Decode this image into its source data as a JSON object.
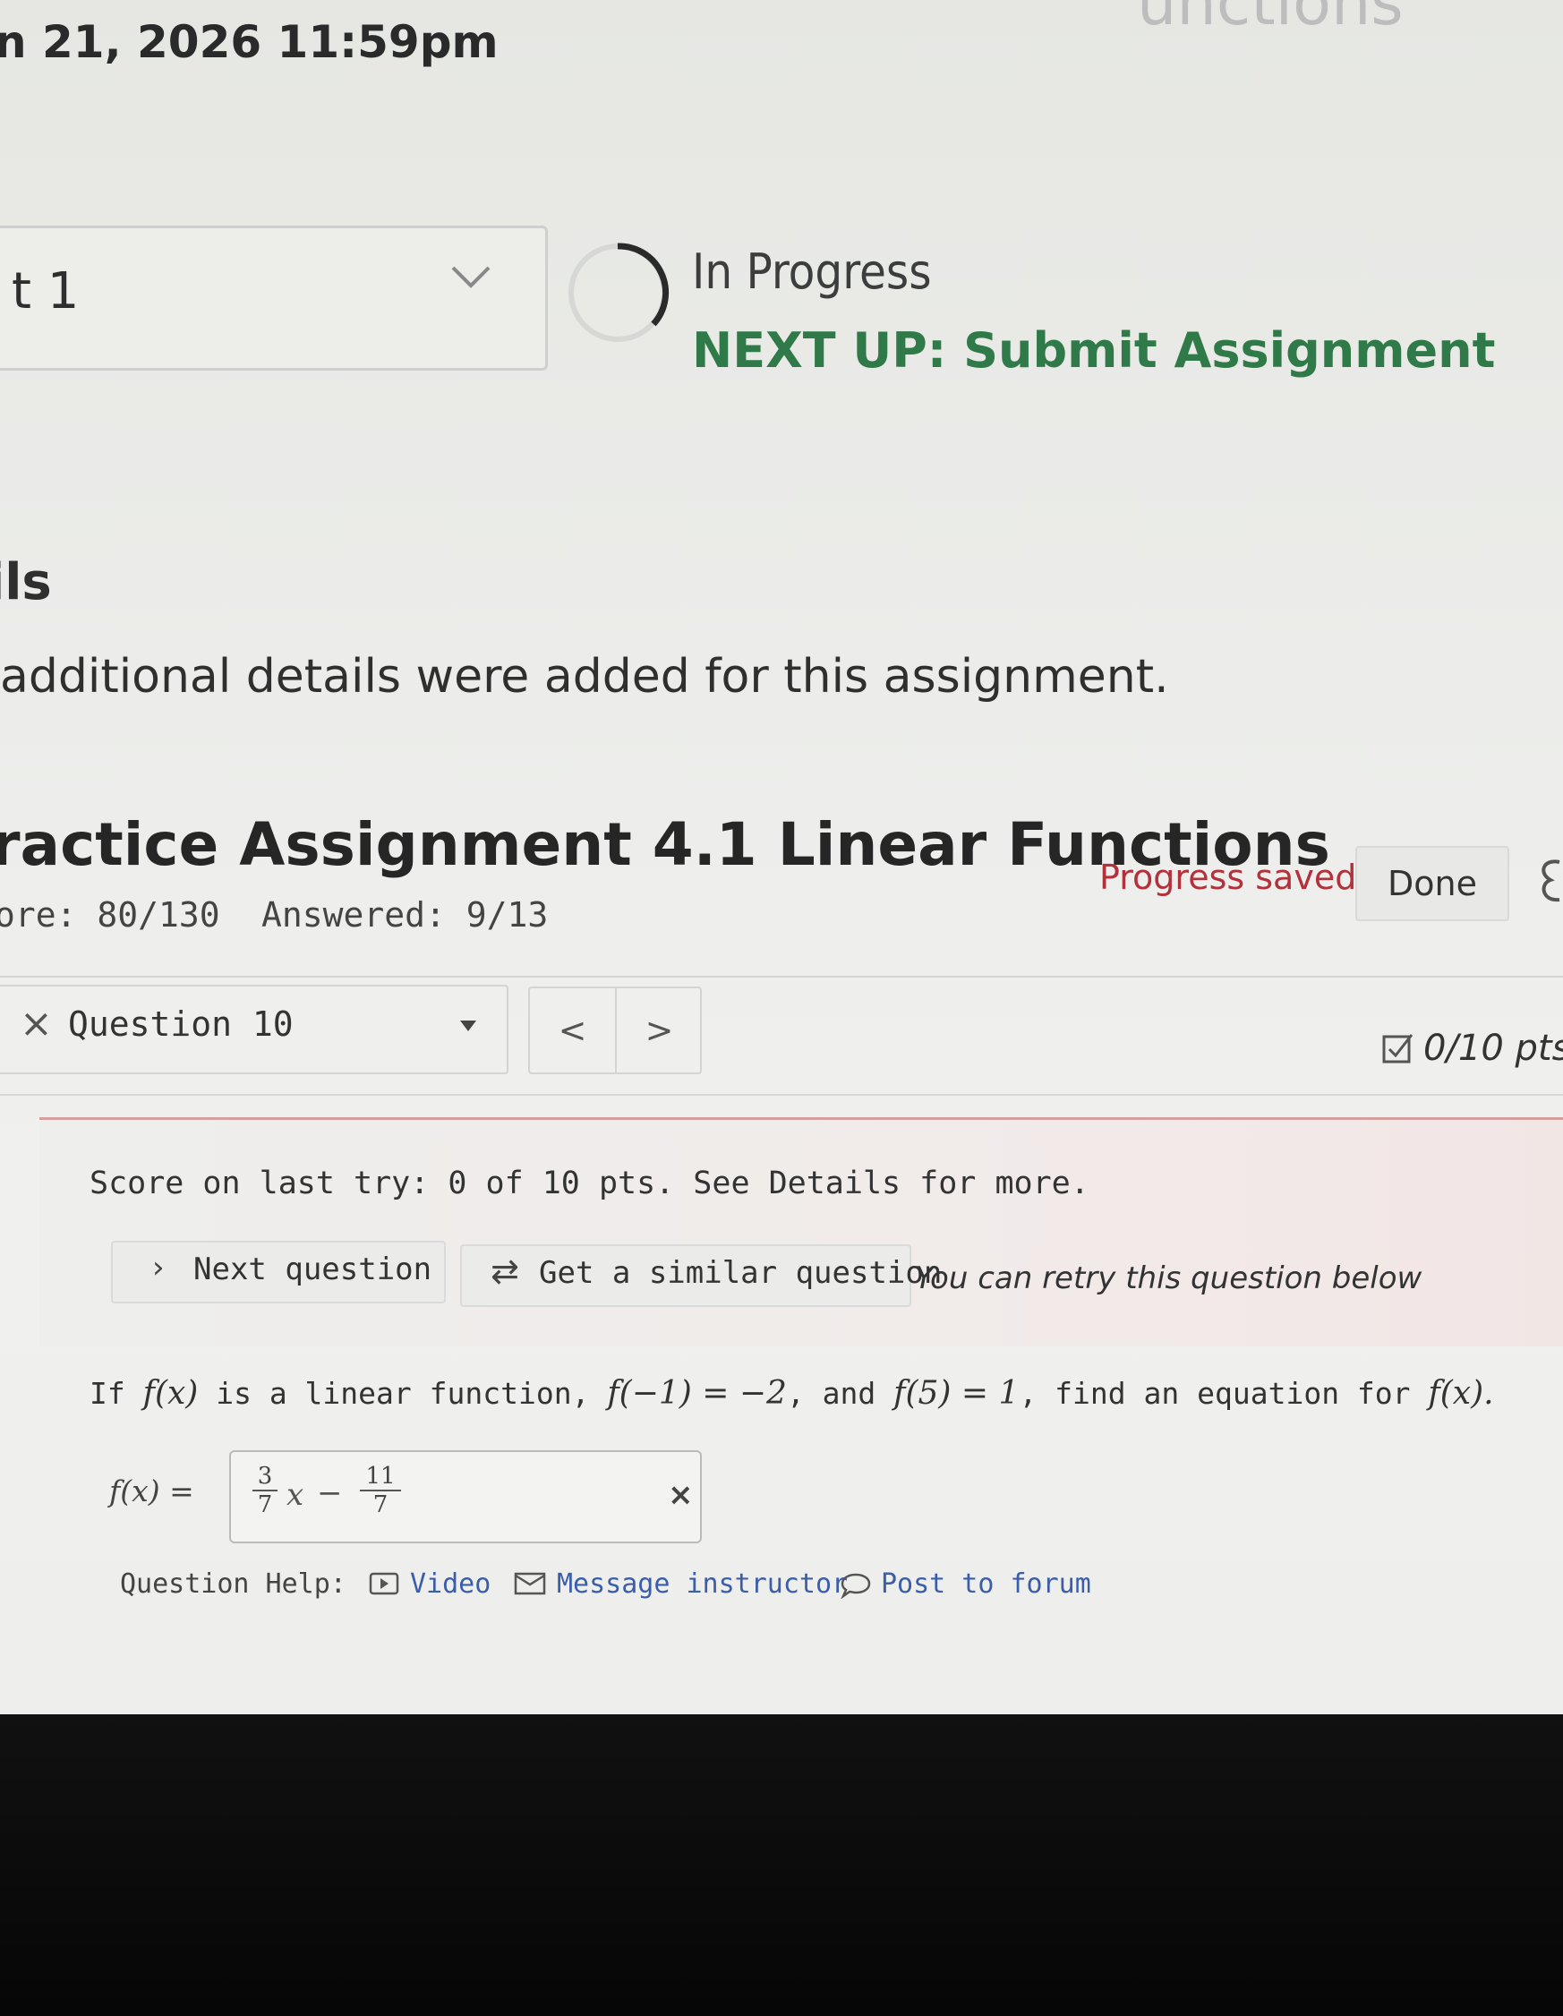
{
  "header": {
    "due_date": "n 21, 2026 11:59pm",
    "title_fragment": "unctions"
  },
  "attempt": {
    "select_label": "t 1",
    "status": "In Progress",
    "next_up": "NEXT UP: Submit Assignment"
  },
  "details": {
    "heading": "ils",
    "text": "additional details were added for this assignment."
  },
  "assignment": {
    "title": "ractice Assignment 4.1 Linear Functions",
    "progress_saved": "Progress saved",
    "done_label": "Done",
    "score": "ore: 80/130",
    "answered": "Answered: 9/13"
  },
  "question_nav": {
    "status_icon": "×",
    "label": "Question 10",
    "prev": "<",
    "next": ">",
    "points": "0/10 pts"
  },
  "feedback": {
    "text": "Score on last try: 0 of 10 pts. See Details for more.",
    "next_question": "Next question",
    "similar_question": "Get a similar question",
    "retry_text": "You can retry this question below"
  },
  "question": {
    "intro": "If",
    "fx": "f(x)",
    "middle1": "is a linear function,",
    "cond1": "f(−1) = −2",
    "middle2": ", and",
    "cond2": "f(5) = 1",
    "middle3": ", find an equation for",
    "fx2": "f(x).",
    "answer_prefix": "f(x) =",
    "answer": {
      "coef_num": "3",
      "coef_den": "7",
      "var": "x",
      "op": "−",
      "const_num": "11",
      "const_den": "7"
    },
    "wrong_mark": "×"
  },
  "help": {
    "label": "Question Help:",
    "video": "Video",
    "message": "Message instructor",
    "forum": "Post to forum"
  },
  "colors": {
    "next_up": "#2f7a48",
    "progress_saved": "#b3313a",
    "link": "#3b5ea8",
    "feedback_rule": "#c97a7a"
  }
}
